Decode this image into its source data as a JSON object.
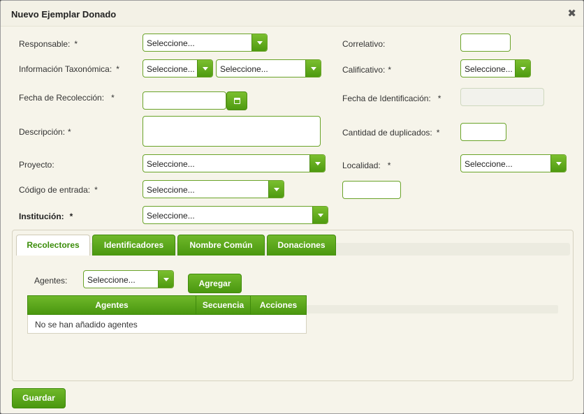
{
  "dialog": {
    "title": "Nuevo Ejemplar Donado",
    "close_glyph": "✖"
  },
  "required_mark": "*",
  "form": {
    "responsable": {
      "label": "Responsable:",
      "value": "Seleccione..."
    },
    "informacion_taxonomica": {
      "label": "Información Taxonómica:",
      "value_1": "Seleccione...",
      "value_2": "Seleccione..."
    },
    "fecha_recoleccion": {
      "label": "Fecha de Recolección:",
      "value": ""
    },
    "descripcion": {
      "label": "Descripción:",
      "value": ""
    },
    "proyecto": {
      "label": "Proyecto:",
      "value": "Seleccione..."
    },
    "codigo_entrada": {
      "label": "Código de entrada:",
      "value": "Seleccione...",
      "extra_value": ""
    },
    "institucion": {
      "label": "Institución:",
      "value": "Seleccione..."
    },
    "correlativo": {
      "label": "Correlativo:",
      "value": ""
    },
    "calificativo": {
      "label": "Calificativo:",
      "value": "Seleccione..."
    },
    "fecha_identificacion": {
      "label": "Fecha de Identificación:",
      "value": ""
    },
    "cantidad_duplicados": {
      "label": "Cantidad de duplicados:",
      "value": ""
    },
    "localidad": {
      "label": "Localidad:",
      "value": "Seleccione..."
    }
  },
  "tabs": [
    {
      "label": "Recolectores",
      "active": true
    },
    {
      "label": "Identificadores",
      "active": false
    },
    {
      "label": "Nombre Común",
      "active": false
    },
    {
      "label": "Donaciones",
      "active": false
    }
  ],
  "recolectores": {
    "agentes_label": "Agentes:",
    "agentes_value": "Seleccione...",
    "agregar_label": "Agregar",
    "table": {
      "columns": [
        "Agentes",
        "Secuencia",
        "Acciones"
      ],
      "empty_message": "No se han añadido agentes"
    }
  },
  "footer": {
    "save_label": "Guardar"
  },
  "colors": {
    "accent": "#5aa81c",
    "accent_dark": "#3f8a0c",
    "background": "#f6f4ea"
  }
}
